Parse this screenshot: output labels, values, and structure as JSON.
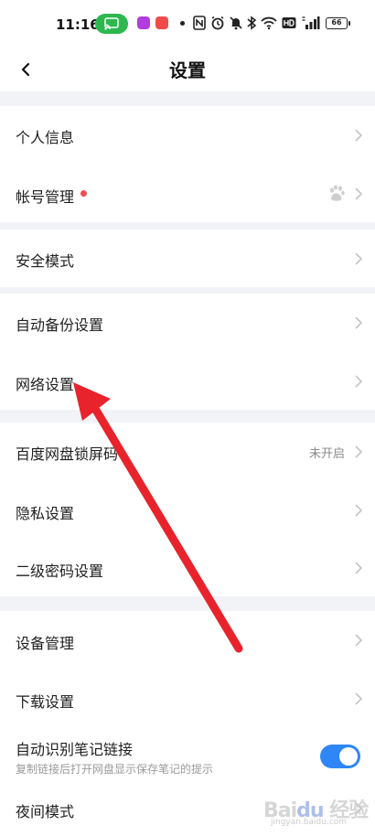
{
  "status_bar": {
    "time": "11:16",
    "battery": "66",
    "icons": [
      "cast-icon",
      "app-icon",
      "app-icon",
      "nfc-icon",
      "alarm-icon",
      "mute-icon",
      "bluetooth-icon",
      "wifi-icon",
      "hd-icon",
      "signal-icon",
      "battery-icon"
    ]
  },
  "header": {
    "title": "设置",
    "back_icon": "chevron-left-icon"
  },
  "groups": {
    "account": {
      "personal_info": "个人信息",
      "account_manage": "帐号管理"
    },
    "security": {
      "safe_mode": "安全模式"
    },
    "network": {
      "auto_backup": "自动备份设置",
      "network_settings": "网络设置"
    },
    "privacy": {
      "lock_screen": "百度网盘锁屏码",
      "lock_screen_value": "未开启",
      "privacy_settings": "隐私设置",
      "second_password": "二级密码设置"
    },
    "general": {
      "device_manage": "设备管理",
      "download_settings": "下载设置",
      "note_link": "自动识别笔记链接",
      "note_link_desc": "复制链接后打开网盘显示保存笔记的提示",
      "note_link_enabled": true,
      "night_mode": "夜间模式"
    }
  },
  "colors": {
    "accent": "#2f86f6",
    "badge": "#f24c4c",
    "annotation_arrow": "#e8232c"
  }
}
